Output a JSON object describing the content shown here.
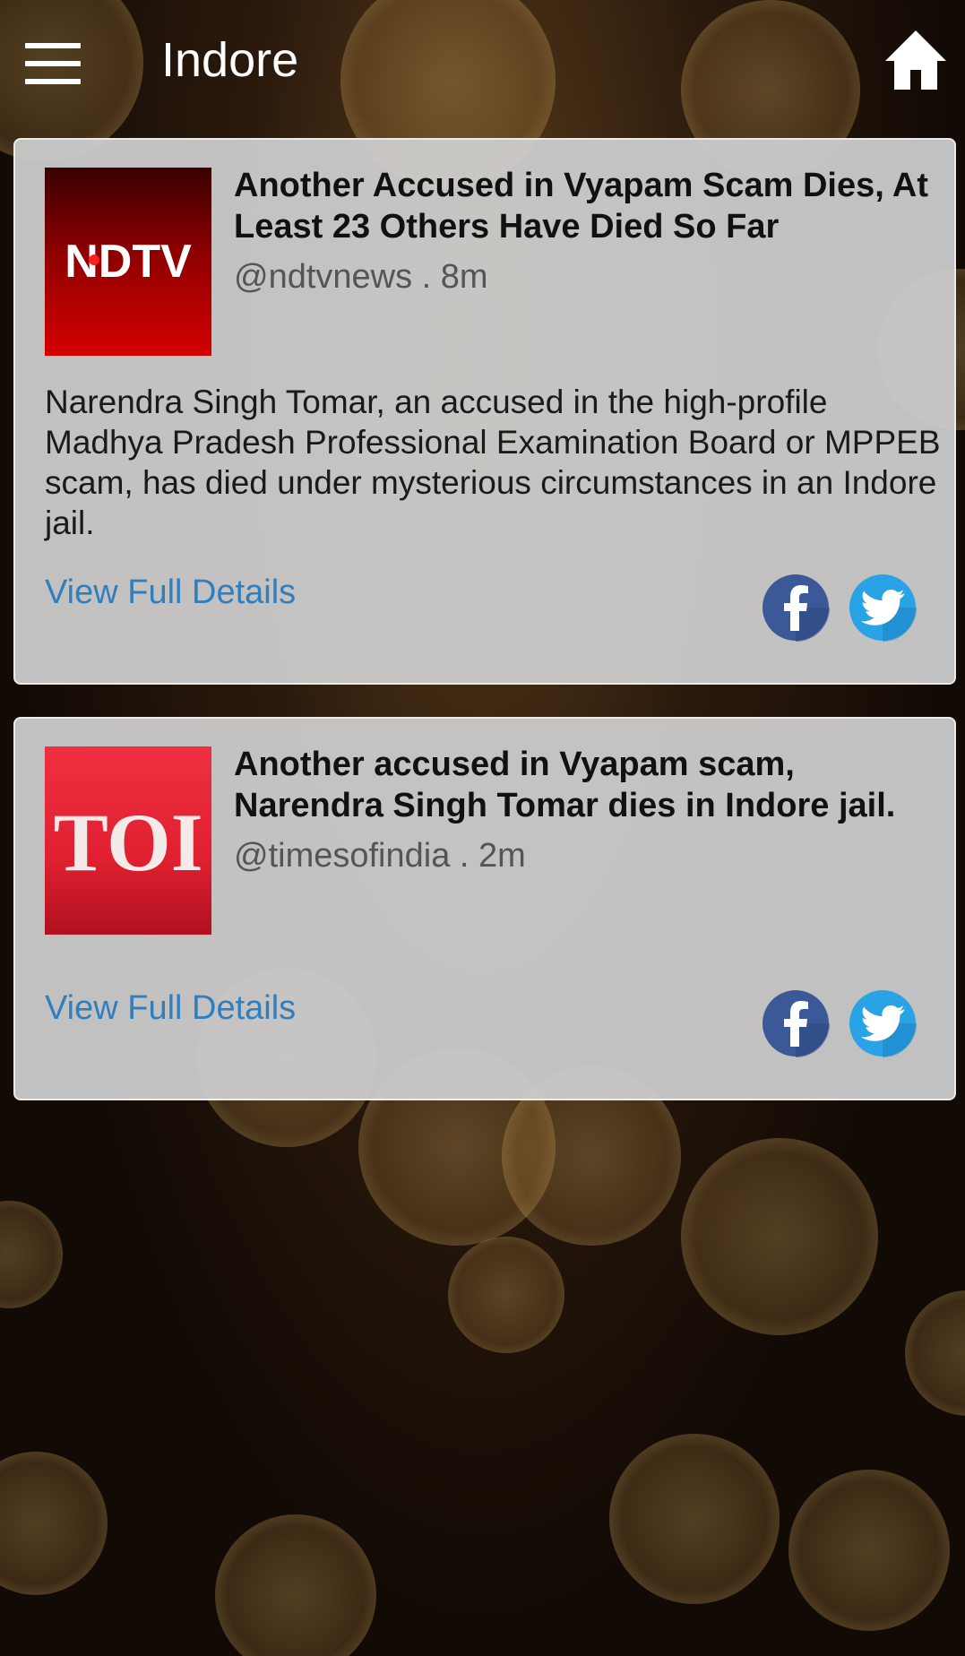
{
  "header": {
    "title": "Indore",
    "menu_icon": "hamburger-menu-icon",
    "home_icon": "home-icon"
  },
  "posts": [
    {
      "source_logo": "NDTV",
      "headline": "Another Accused in Vyapam Scam Dies, At Least 23 Others Have Died So Far",
      "meta": "@ndtvnews . 8m",
      "summary": "Narendra Singh Tomar, an accused in the high-profile Madhya Pradesh Professional Examination Board or MPPEB scam, has died under mysterious circumstances in an Indore jail.",
      "link_label": "View Full Details"
    },
    {
      "source_logo": "TOI",
      "headline": "Another accused in Vyapam scam, Narendra Singh Tomar dies in Indore jail.",
      "meta": "@timesofindia . 2m",
      "summary": "",
      "link_label": "View Full Details"
    }
  ],
  "colors": {
    "link": "#2f7fc0",
    "facebook": "#3b5998",
    "twitter": "#2aa3e6",
    "ndtv_red": "#c20000",
    "toi_red": "#e02030"
  }
}
